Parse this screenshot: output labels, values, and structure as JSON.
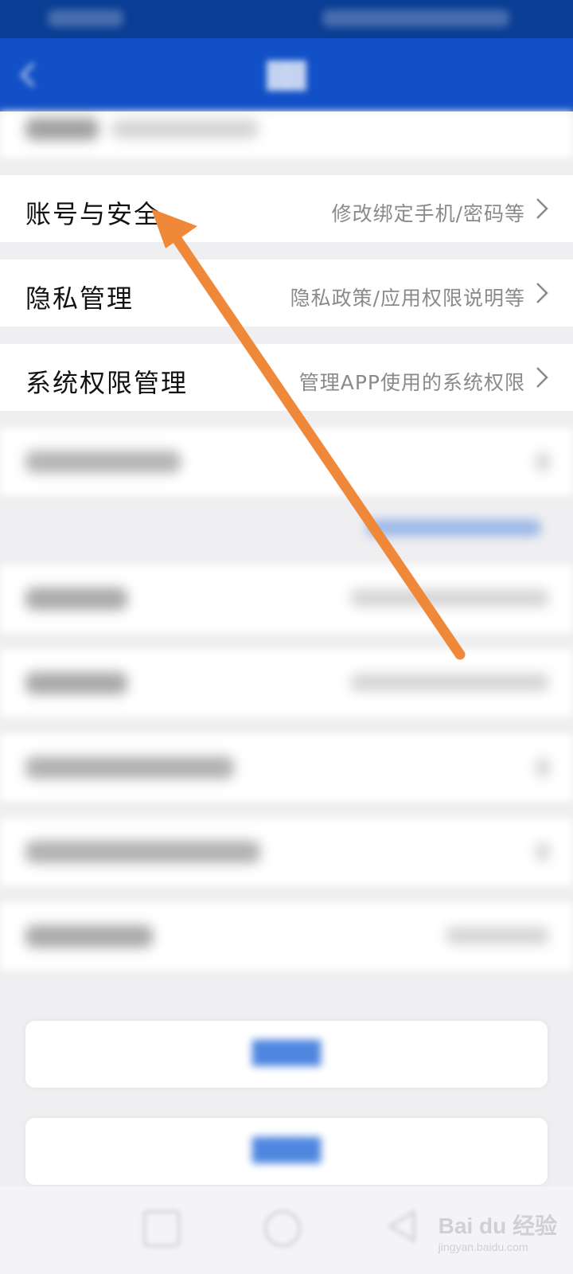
{
  "rows": {
    "account_security": {
      "label": "账号与安全",
      "value": "修改绑定手机/密码等"
    },
    "privacy": {
      "label": "隐私管理",
      "value": "隐私政策/应用权限说明等"
    },
    "system_permissions": {
      "label": "系统权限管理",
      "value": "管理APP使用的系统权限"
    }
  },
  "watermark": {
    "brand": "Bai du 经验",
    "url": "jingyan.baidu.com"
  },
  "colors": {
    "status_bar": "#0a3d94",
    "nav_bar": "#1150c6",
    "annotation_arrow": "#f0883a"
  },
  "icons": {
    "back": "chevron-left-icon",
    "row_chevron": "chevron-right-icon",
    "annotation": "arrow-pointer-icon"
  }
}
